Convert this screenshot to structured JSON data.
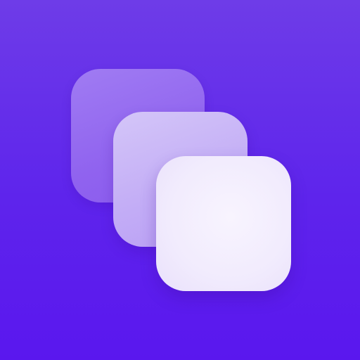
{
  "app_icon": {
    "name": "",
    "colors": {
      "background_top": "#6e3ce8",
      "background_bottom": "#5a17ee",
      "back_layer": "#9063ef",
      "middle_layer": "#c3adf6",
      "front_layer": "#f4effd"
    },
    "layers": [
      {
        "id": "back",
        "icon": "rounded-square-icon"
      },
      {
        "id": "middle",
        "icon": "rounded-square-icon"
      },
      {
        "id": "front",
        "icon": "rounded-square-icon"
      }
    ]
  }
}
